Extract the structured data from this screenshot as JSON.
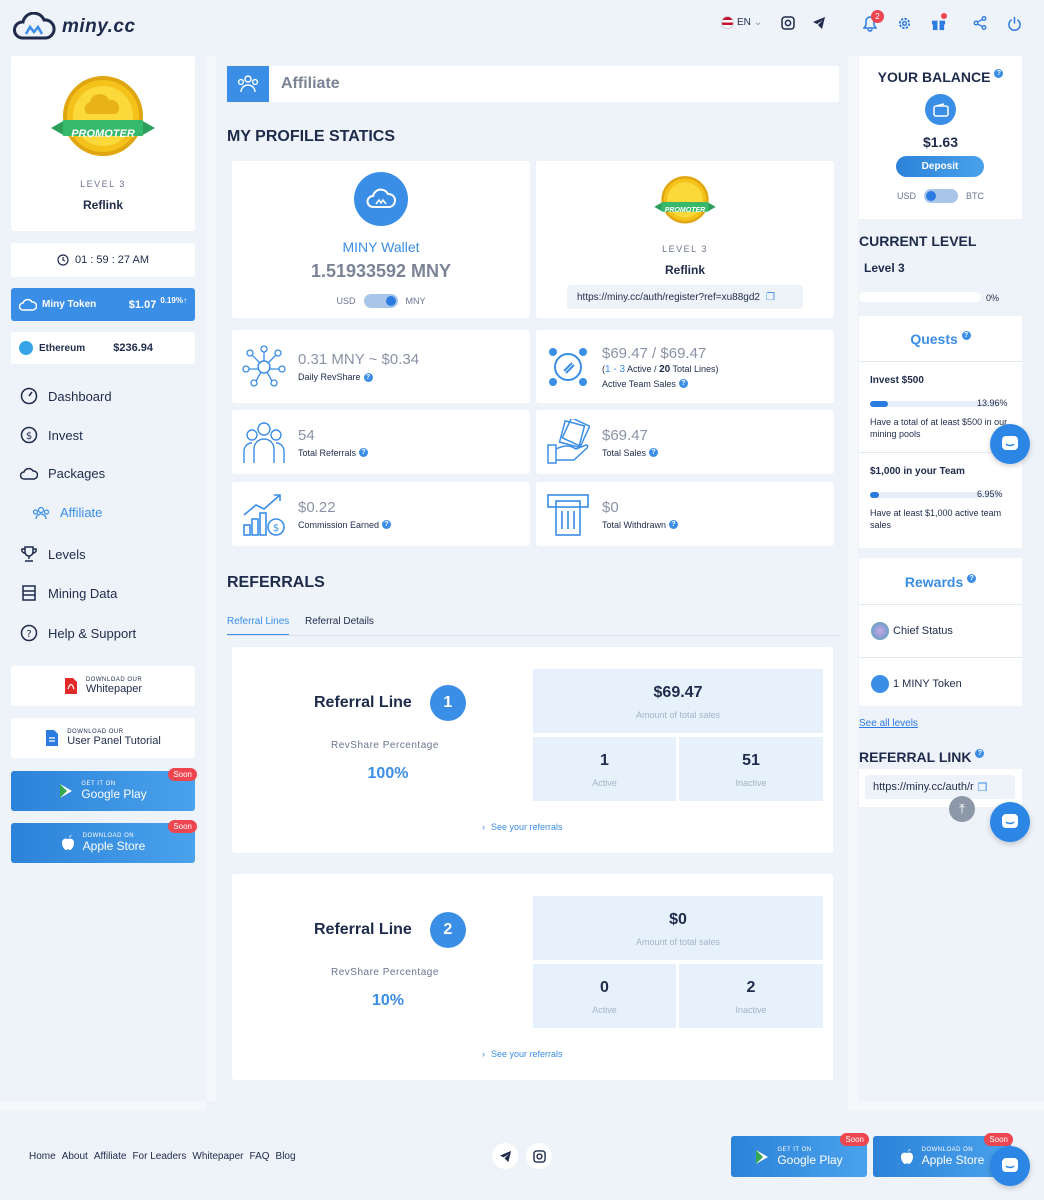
{
  "app": {
    "logo_text": "miny.cc",
    "language": "EN",
    "notifications_count": "2"
  },
  "sidebar": {
    "promo": {
      "badge_text": "PROMOTER",
      "level": "LEVEL 3",
      "name": "Reflink"
    },
    "clock": "01 : 59 : 27 AM",
    "token": {
      "name": "Miny Token",
      "price": "$1.07",
      "change": "0.19%↑"
    },
    "eth": {
      "name": "Ethereum",
      "price": "$236.94"
    },
    "nav": [
      "Dashboard",
      "Invest",
      "Packages",
      "Affiliate",
      "Levels",
      "Mining Data",
      "Help & Support"
    ],
    "downloads": [
      {
        "t1": "DOWNLOAD OUR",
        "t2": "Whitepaper"
      },
      {
        "t1": "DOWNLOAD OUR",
        "t2": "User Panel Tutorial"
      },
      {
        "t1": "GET IT ON",
        "t2": "Google Play",
        "soon": "Soon"
      },
      {
        "t1": "DOWNLOAD ON",
        "t2": "Apple Store",
        "soon": "Soon"
      }
    ]
  },
  "main": {
    "header": "Affiliate",
    "profile_title": "MY PROFILE STATICS",
    "wallet": {
      "label": "MINY Wallet",
      "amount": "1.51933592 MNY",
      "left": "USD",
      "right": "MNY"
    },
    "level_card": {
      "badge_text": "PROMOTER",
      "level": "LEVEL 3",
      "name": "Reflink",
      "link": "https://miny.cc/auth/register?ref=xu88gd2"
    },
    "stats": [
      {
        "value": "0.31 MNY ~ $0.34",
        "label": "Daily RevShare"
      },
      {
        "value": "$69.47 / $69.47",
        "sub_a": "1 - 3",
        "sub_b": "Active /",
        "sub_c": "20",
        "sub_d": "Total Lines)",
        "label": "Active Team Sales"
      },
      {
        "value": "54",
        "label": "Total Referrals"
      },
      {
        "value": "$69.47",
        "label": "Total Sales"
      },
      {
        "value": "$0.22",
        "label": "Commission Earned"
      },
      {
        "value": "$0",
        "label": "Total Withdrawn"
      }
    ],
    "referrals_title": "REFERRALS",
    "tabs": [
      "Referral Lines",
      "Referral Details"
    ],
    "lines": [
      {
        "title": "Referral Line",
        "num": "1",
        "rev_label": "RevShare Percentage",
        "rev": "100%",
        "total": "$69.47",
        "total_label": "Amount of total sales",
        "active": "1",
        "active_label": "Active",
        "inactive": "51",
        "inactive_label": "Inactive",
        "see": "See your referrals"
      },
      {
        "title": "Referral Line",
        "num": "2",
        "rev_label": "RevShare Percentage",
        "rev": "10%",
        "total": "$0",
        "total_label": "Amount of total sales",
        "active": "0",
        "active_label": "Active",
        "inactive": "2",
        "inactive_label": "Inactive",
        "see": "See your referrals"
      }
    ]
  },
  "right": {
    "balance": {
      "title": "YOUR BALANCE",
      "amount": "$1.63",
      "deposit": "Deposit",
      "left": "USD",
      "right": "BTC"
    },
    "current_level": {
      "title": "CURRENT LEVEL",
      "level": "Level 3",
      "pct": "0%",
      "progress": 0
    },
    "quests": {
      "title": "Quests",
      "items": [
        {
          "name": "Invest $500",
          "pct": "13.96%",
          "progress": 0.1396,
          "desc": "Have a total of at least $500 in our mining pools"
        },
        {
          "name": "$1,000 in your Team",
          "pct": "6.95%",
          "progress": 0.0695,
          "desc": "Have at least $1,000 active team sales"
        }
      ]
    },
    "rewards": {
      "title": "Rewards",
      "items": [
        "Chief Status",
        "1 MINY Token"
      ]
    },
    "see_all": "See all levels",
    "referral_link": {
      "title": "REFERRAL LINK",
      "value": "https://miny.cc/auth/r"
    }
  },
  "footer": {
    "links": [
      "Home",
      "About",
      "Affiliate",
      "For Leaders",
      "Whitepaper",
      "FAQ",
      "Blog"
    ],
    "google": {
      "t1": "GET IT ON",
      "t2": "Google Play",
      "soon": "Soon"
    },
    "apple": {
      "t1": "DOWNLOAD ON",
      "t2": "Apple Store",
      "soon": "Soon"
    }
  },
  "colors": {
    "accent": "#3b8ee6",
    "danger": "#ee4650",
    "bg": "#eef2f9"
  }
}
